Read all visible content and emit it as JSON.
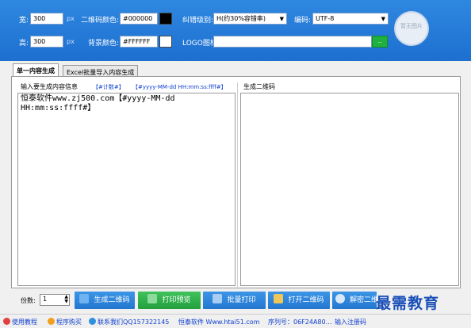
{
  "toolbar": {
    "width_label": "宽:",
    "width_value": "300",
    "height_label": "高:",
    "height_value": "300",
    "unit": "px",
    "qr_color_label": "二维码颜色:",
    "qr_color_value": "#000000",
    "qr_color_swatch": "#000000",
    "bg_color_label": "背景颜色:",
    "bg_color_value": "#FFFFFF",
    "bg_color_swatch": "#FFFFFF",
    "ec_label": "纠错级别:",
    "ec_value": "H(约30%容错率)",
    "encoding_label": "编码:",
    "encoding_value": "UTF-8",
    "logo_label": "LOGO图标:",
    "logo_value": "",
    "browse_label": "..",
    "preview_text": "暂无图片"
  },
  "tabs": [
    {
      "label": "单一内容生成",
      "active": true
    },
    {
      "label": "Excel批量导入内容生成",
      "active": false
    }
  ],
  "input_section": {
    "title": "输入要生成内容信息",
    "link1": "【#计数#】",
    "link2": "【#yyyy-MM-dd HH:mm:ss:ffff#】",
    "content_line1": "恒泰软件www.zj500.com【#yyyy-MM-dd",
    "content_line2": "HH:mm:ss:ffff#】"
  },
  "output_section": {
    "title": "生成二维码"
  },
  "bottom": {
    "copies_label": "份数:",
    "copies_value": "1",
    "buttons": [
      {
        "label": "生成二维码"
      },
      {
        "label": "打印预览"
      },
      {
        "label": "批量打印"
      },
      {
        "label": "打开二维码"
      },
      {
        "label": "解密二维"
      }
    ]
  },
  "status": {
    "items": [
      {
        "label": "使用教程"
      },
      {
        "label": "程序购买"
      },
      {
        "label": "联系我们QQ157322145"
      },
      {
        "label": "恒泰软件 Www.htai51.com"
      },
      {
        "label": "序列号：06F24A80..."
      },
      {
        "label": "输入注册码"
      }
    ]
  },
  "watermark": "最需教育",
  "colors": {
    "header_blue": "#1d6fd0",
    "button_blue": "#2377cf",
    "button_green": "#22a03e",
    "link_blue": "#1040d0"
  }
}
